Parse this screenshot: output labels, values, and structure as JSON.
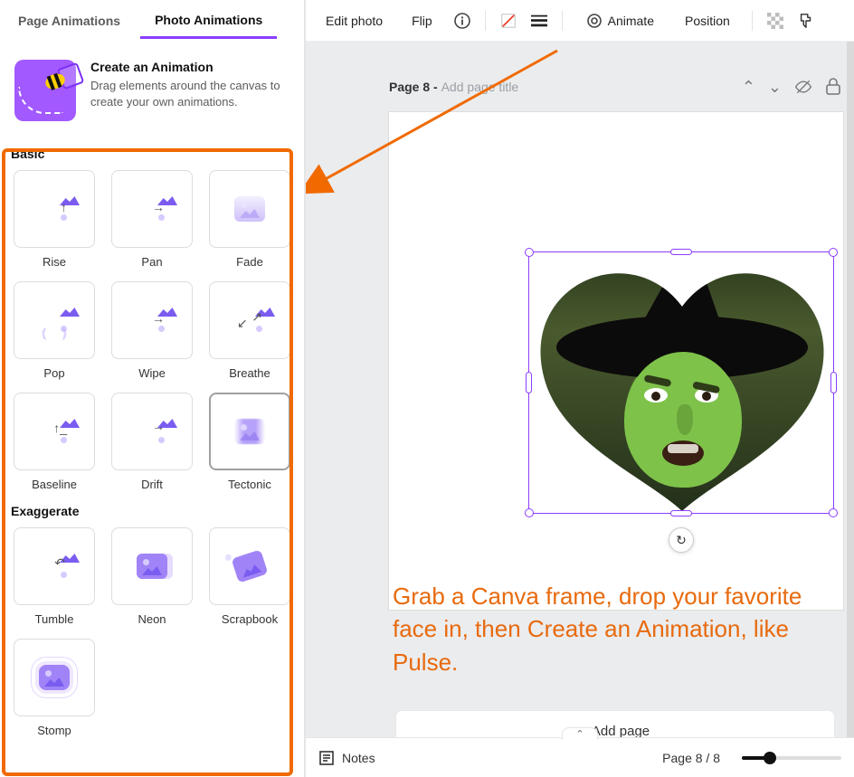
{
  "tabs": {
    "page": "Page Animations",
    "photo": "Photo Animations",
    "active": "photo"
  },
  "create": {
    "title": "Create an Animation",
    "desc": "Drag elements around the canvas to create your own animations."
  },
  "sections": {
    "basic": "Basic",
    "exaggerate": "Exaggerate"
  },
  "anims": {
    "basic": [
      {
        "label": "Rise"
      },
      {
        "label": "Pan"
      },
      {
        "label": "Fade"
      },
      {
        "label": "Pop"
      },
      {
        "label": "Wipe"
      },
      {
        "label": "Breathe"
      },
      {
        "label": "Baseline"
      },
      {
        "label": "Drift"
      },
      {
        "label": "Tectonic"
      }
    ],
    "exaggerate": [
      {
        "label": "Tumble"
      },
      {
        "label": "Neon"
      },
      {
        "label": "Scrapbook"
      },
      {
        "label": "Stomp"
      }
    ],
    "selected": "Tectonic"
  },
  "toolbar": {
    "edit": "Edit photo",
    "flip": "Flip",
    "animate": "Animate",
    "position": "Position"
  },
  "page": {
    "label": "Page 8",
    "sep": " - ",
    "placeholder": "Add page title"
  },
  "caption": "Grab a Canva frame, drop your favorite face in, then Create an Animation, like Pulse.",
  "add_page": "+ Add page",
  "footer": {
    "notes": "Notes",
    "page_count": "Page 8 / 8"
  },
  "colors": {
    "orange": "#f06a00",
    "accent": "#8b3dff"
  }
}
